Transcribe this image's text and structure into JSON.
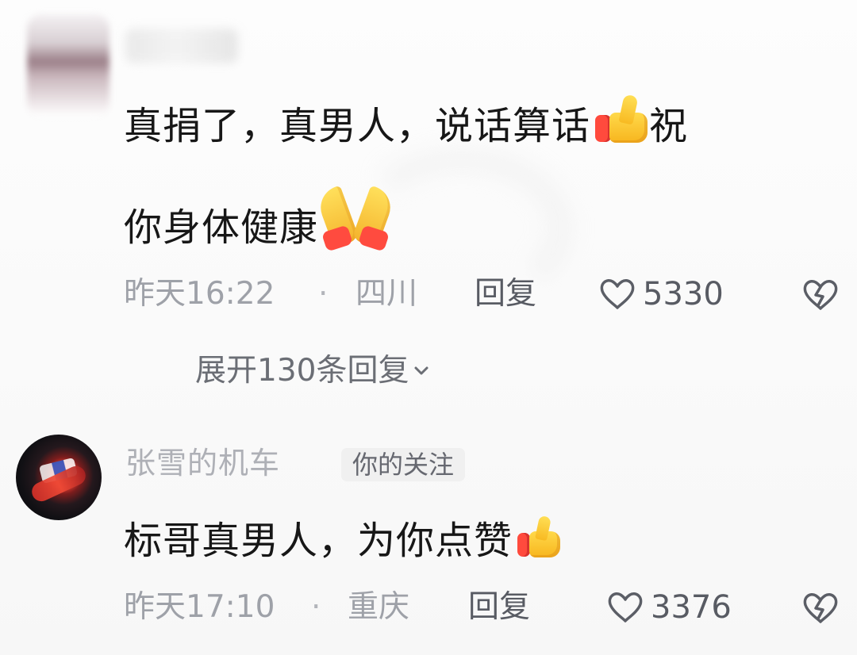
{
  "comments": [
    {
      "username": "",
      "text_line_1": "真捐了，真男人，说话算话",
      "emoji_1": "thumbs-up",
      "text_after_emoji": "祝",
      "text_line_2": "你身体健康",
      "emoji_2": "folded-hands",
      "time": "昨天16:22",
      "separator": "·",
      "location": "四川",
      "reply_label": "回复",
      "like_count": "5330",
      "dislike_icon": "broken-heart-icon",
      "expand_replies_label": "展开130条回复"
    },
    {
      "username": "张雪的机车",
      "follow_badge": "你的关注",
      "text": "标哥真男人，为你点赞",
      "emoji": "thumbs-up",
      "time": "昨天17:10",
      "separator": "·",
      "location": "重庆",
      "reply_label": "回复",
      "like_count": "3376",
      "dislike_icon": "broken-heart-icon"
    }
  ],
  "colors": {
    "background": "#fbfbfb",
    "primary_text": "#171717",
    "meta_text": "#9ea1a8",
    "action_text": "#585b63",
    "badge_background": "#f0f0f0"
  }
}
